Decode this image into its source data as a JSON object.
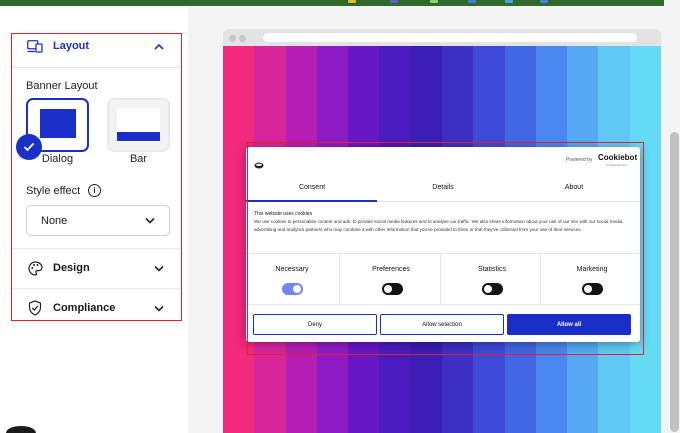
{
  "sidebar": {
    "layout": {
      "label": "Layout"
    },
    "banner_layout": {
      "label": "Banner Layout",
      "options": [
        {
          "label": "Dialog",
          "selected": true
        },
        {
          "label": "Bar",
          "selected": false
        }
      ]
    },
    "style_effect": {
      "label": "Style effect",
      "value": "None"
    },
    "design": {
      "label": "Design"
    },
    "compliance": {
      "label": "Compliance"
    }
  },
  "consent_banner": {
    "powered_by": "Powered by",
    "brand": "Cookiebot",
    "brand_sub": "by Usercentrics",
    "tabs": [
      {
        "label": "Consent",
        "active": true
      },
      {
        "label": "Details",
        "active": false
      },
      {
        "label": "About",
        "active": false
      }
    ],
    "title": "This website uses cookies",
    "body": "We use cookies to personalise content and ads, to provide social media features and to analyse our traffic. We also share information about your use of our site with our social media, advertising and analytics partners who may combine it with other information that you've provided to them or that they've collected from your use of their services.",
    "categories": [
      {
        "label": "Necessary",
        "enabled": true
      },
      {
        "label": "Preferences",
        "enabled": false
      },
      {
        "label": "Statistics",
        "enabled": false
      },
      {
        "label": "Marketing",
        "enabled": false
      }
    ],
    "buttons": {
      "deny": "Deny",
      "allow_selection": "Allow selection",
      "allow_all": "Allow all"
    }
  },
  "colors": {
    "accent": "#1a2fc7",
    "highlight": "#e0202a",
    "toggle_on": "#7186f0",
    "gradient": [
      "#f02a7c",
      "#d6269a",
      "#b51fb5",
      "#8d1cc4",
      "#6717c4",
      "#4a1bbd",
      "#3a1db5",
      "#3c2fc2",
      "#3f4ad6",
      "#4166e4",
      "#4a87ee",
      "#55a9f2",
      "#60c8f4",
      "#64daf4"
    ]
  }
}
